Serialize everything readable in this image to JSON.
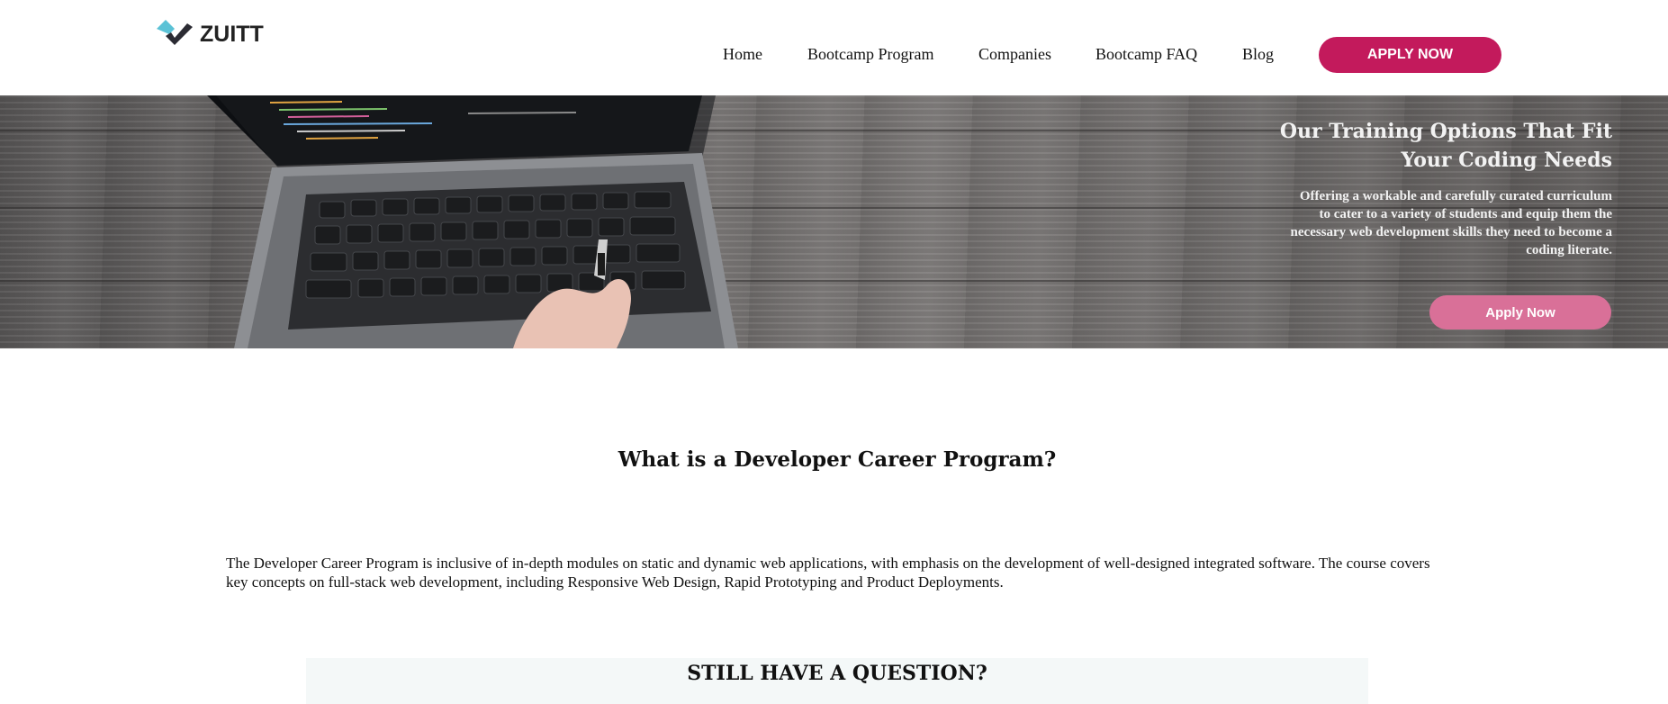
{
  "brand": {
    "name": "ZUITT",
    "colors": {
      "accent": "#c31a5c",
      "logo_teal": "#5bc2d6",
      "logo_dark": "#2b2b33"
    }
  },
  "nav": {
    "items": [
      {
        "label": "Home"
      },
      {
        "label": "Bootcamp Program"
      },
      {
        "label": "Companies"
      },
      {
        "label": "Bootcamp FAQ"
      },
      {
        "label": "Blog"
      }
    ],
    "apply_label": "APPLY NOW"
  },
  "hero": {
    "title_line1": "Our Training Options That Fit",
    "title_line2": "Your Coding Needs",
    "description": "Offering a workable and carefully curated curriculum to cater to a variety of students and equip them the necessary web development skills they need to become a coding literate.",
    "cta_label": "Apply Now"
  },
  "main": {
    "heading": "What is a Developer Career Program?",
    "paragraph": "The Developer Career Program is inclusive of in-depth modules on static and dynamic web applications, with emphasis on the development of well-designed integrated software. The course covers key concepts on full-stack web development, including Responsive Web Design, Rapid Prototyping and Product Deployments."
  },
  "question": {
    "heading": "STILL HAVE A QUESTION?"
  }
}
